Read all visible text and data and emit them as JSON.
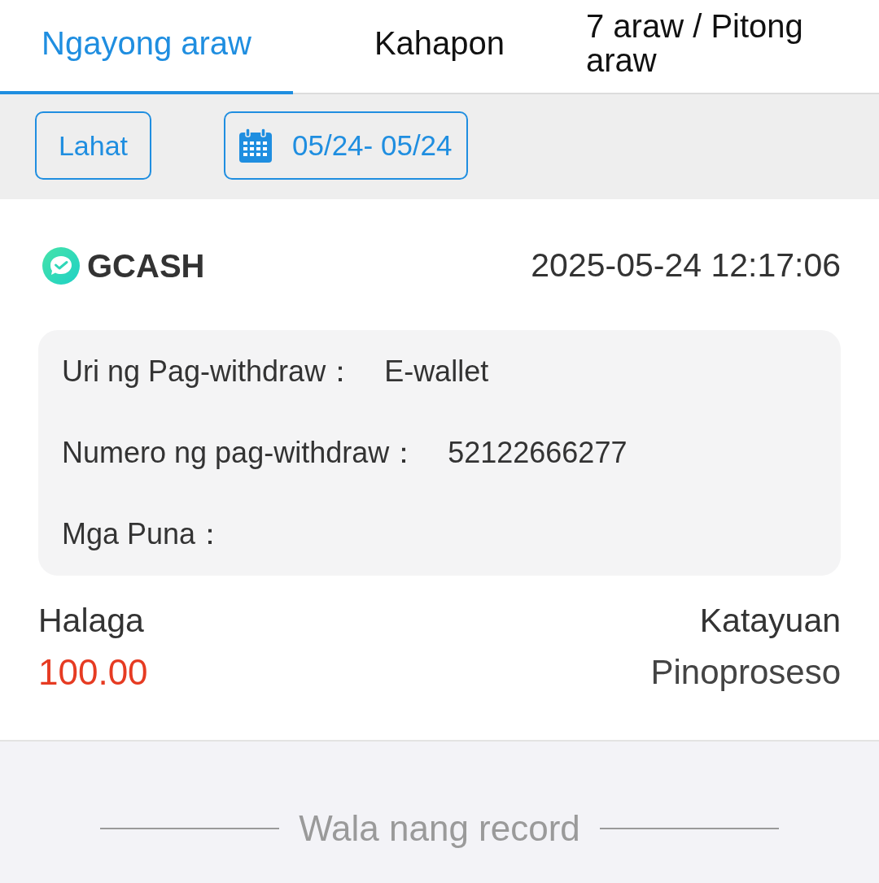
{
  "tabs": [
    {
      "label": "Ngayong araw",
      "selected": true
    },
    {
      "label": "Kahapon",
      "selected": false
    },
    {
      "label": "7 araw / Pitong araw",
      "selected": false
    }
  ],
  "filters": {
    "all_button": "Lahat",
    "date_range": "05/24- 05/24"
  },
  "records": [
    {
      "method": "GCASH",
      "time": "2025-05-24 12:17:06",
      "details": [
        {
          "label": "Uri ng Pag-withdraw：",
          "value": "E-wallet"
        },
        {
          "label": "Numero ng pag-withdraw：",
          "value": "52122666277"
        },
        {
          "label": "Mga Puna："
        }
      ],
      "amount_label": "Halaga",
      "amount": "100.00",
      "status_label": "Katayuan",
      "status": "Pinoproseso"
    }
  ],
  "end_note": "Wala nang record"
}
